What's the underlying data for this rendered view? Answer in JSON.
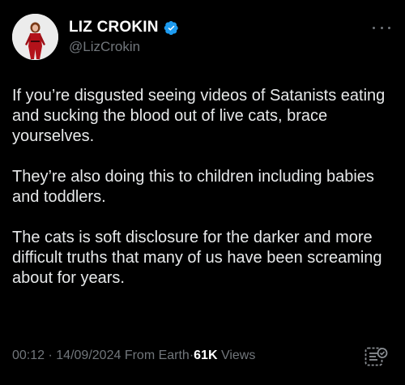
{
  "author": {
    "display_name": "LIZ CROKIN",
    "handle": "@LizCrokin",
    "verified": true
  },
  "post": {
    "paragraphs": [
      "If you’re disgusted seeing videos of Satanists eating and sucking the blood out of live cats, brace yourselves.",
      "They’re also doing this to children including babies and toddlers.",
      "The cats is soft disclosure for the darker and more difficult truths that many of us have been screaming about for years."
    ]
  },
  "meta": {
    "time": "00:12",
    "date": "14/09/2024",
    "source": "From Earth",
    "views_count": "61K",
    "views_label": "Views",
    "separator": "·"
  },
  "icons": {
    "verified": "verified-badge-icon",
    "more": "more-options-icon",
    "analytics": "translate-grok-icon"
  },
  "colors": {
    "background": "#000000",
    "text": "#e7e9ea",
    "secondary_text": "#71767b",
    "verified_blue": "#1d9bf0"
  }
}
